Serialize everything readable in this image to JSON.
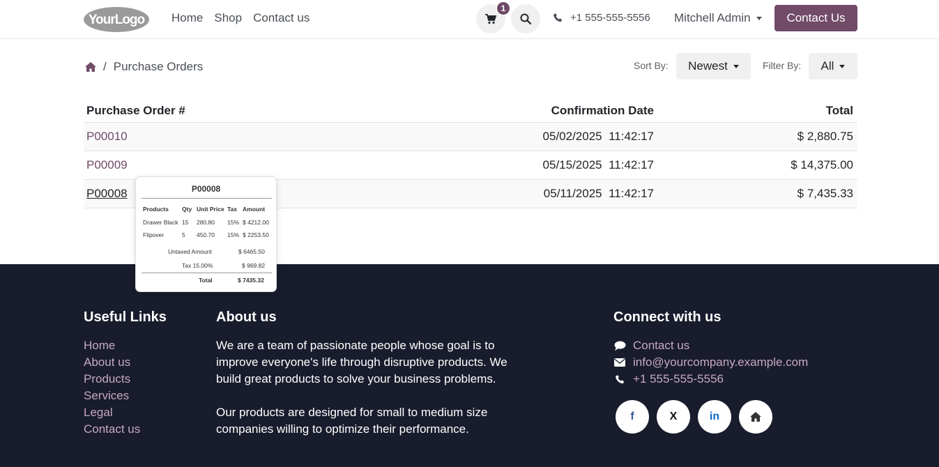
{
  "header": {
    "logo": "YourLogo",
    "nav": [
      "Home",
      "Shop",
      "Contact us"
    ],
    "cart_count": "1",
    "phone": "+1 555-555-5556",
    "user": "Mitchell Admin",
    "cta": "Contact Us"
  },
  "breadcrumb": {
    "current": "Purchase Orders",
    "separator": "/"
  },
  "sort": {
    "label": "Sort By:",
    "value": "Newest"
  },
  "filter": {
    "label": "Filter By:",
    "value": "All"
  },
  "table": {
    "columns": [
      "Purchase Order #",
      "Confirmation Date",
      "Total"
    ],
    "rows": [
      {
        "order": "P00010",
        "date": "05/02/2025",
        "time": "11:42:17",
        "total": "$ 2,880.75"
      },
      {
        "order": "P00009",
        "date": "05/15/2025",
        "time": "11:42:17",
        "total": "$ 14,375.00"
      },
      {
        "order": "P00008",
        "date": "05/11/2025",
        "time": "11:42:17",
        "total": "$ 7,435.33"
      }
    ]
  },
  "popover": {
    "title": "P00008",
    "headers": [
      "Products",
      "Qty",
      "Unit Price",
      "Tax",
      "Amount"
    ],
    "lines": [
      {
        "product": "Drawer Black",
        "qty": "15",
        "price": "280.80",
        "tax": "15%",
        "amount": "$ 4212.00"
      },
      {
        "product": "Flipover",
        "qty": "5",
        "price": "450.70",
        "tax": "15%",
        "amount": "$ 2253.50"
      }
    ],
    "untaxed_label": "Untaxed Amount",
    "untaxed_value": "$ 6465.50",
    "tax_label": "Tax 15.00%",
    "tax_value": "$ 969.82",
    "total_label": "Total",
    "total_value": "$ 7435.32"
  },
  "footer": {
    "useful_title": "Useful Links",
    "useful_links": [
      "Home",
      "About us",
      "Products",
      "Services",
      "Legal",
      "Contact us"
    ],
    "about_title": "About us",
    "about_p1": "We are a team of passionate people whose goal is to improve everyone's life through disruptive products. We build great products to solve your business problems.",
    "about_p2": "Our products are designed for small to medium size companies willing to optimize their performance.",
    "connect_title": "Connect with us",
    "connect_items": [
      "Contact us",
      "info@yourcompany.example.com",
      "+1 555-555-5556"
    ],
    "socials": [
      "f",
      "X",
      "in"
    ]
  },
  "colors": {
    "brand": "#714b67",
    "footer_bg": "#181c2c",
    "footer_link": "#c7a8c2"
  }
}
